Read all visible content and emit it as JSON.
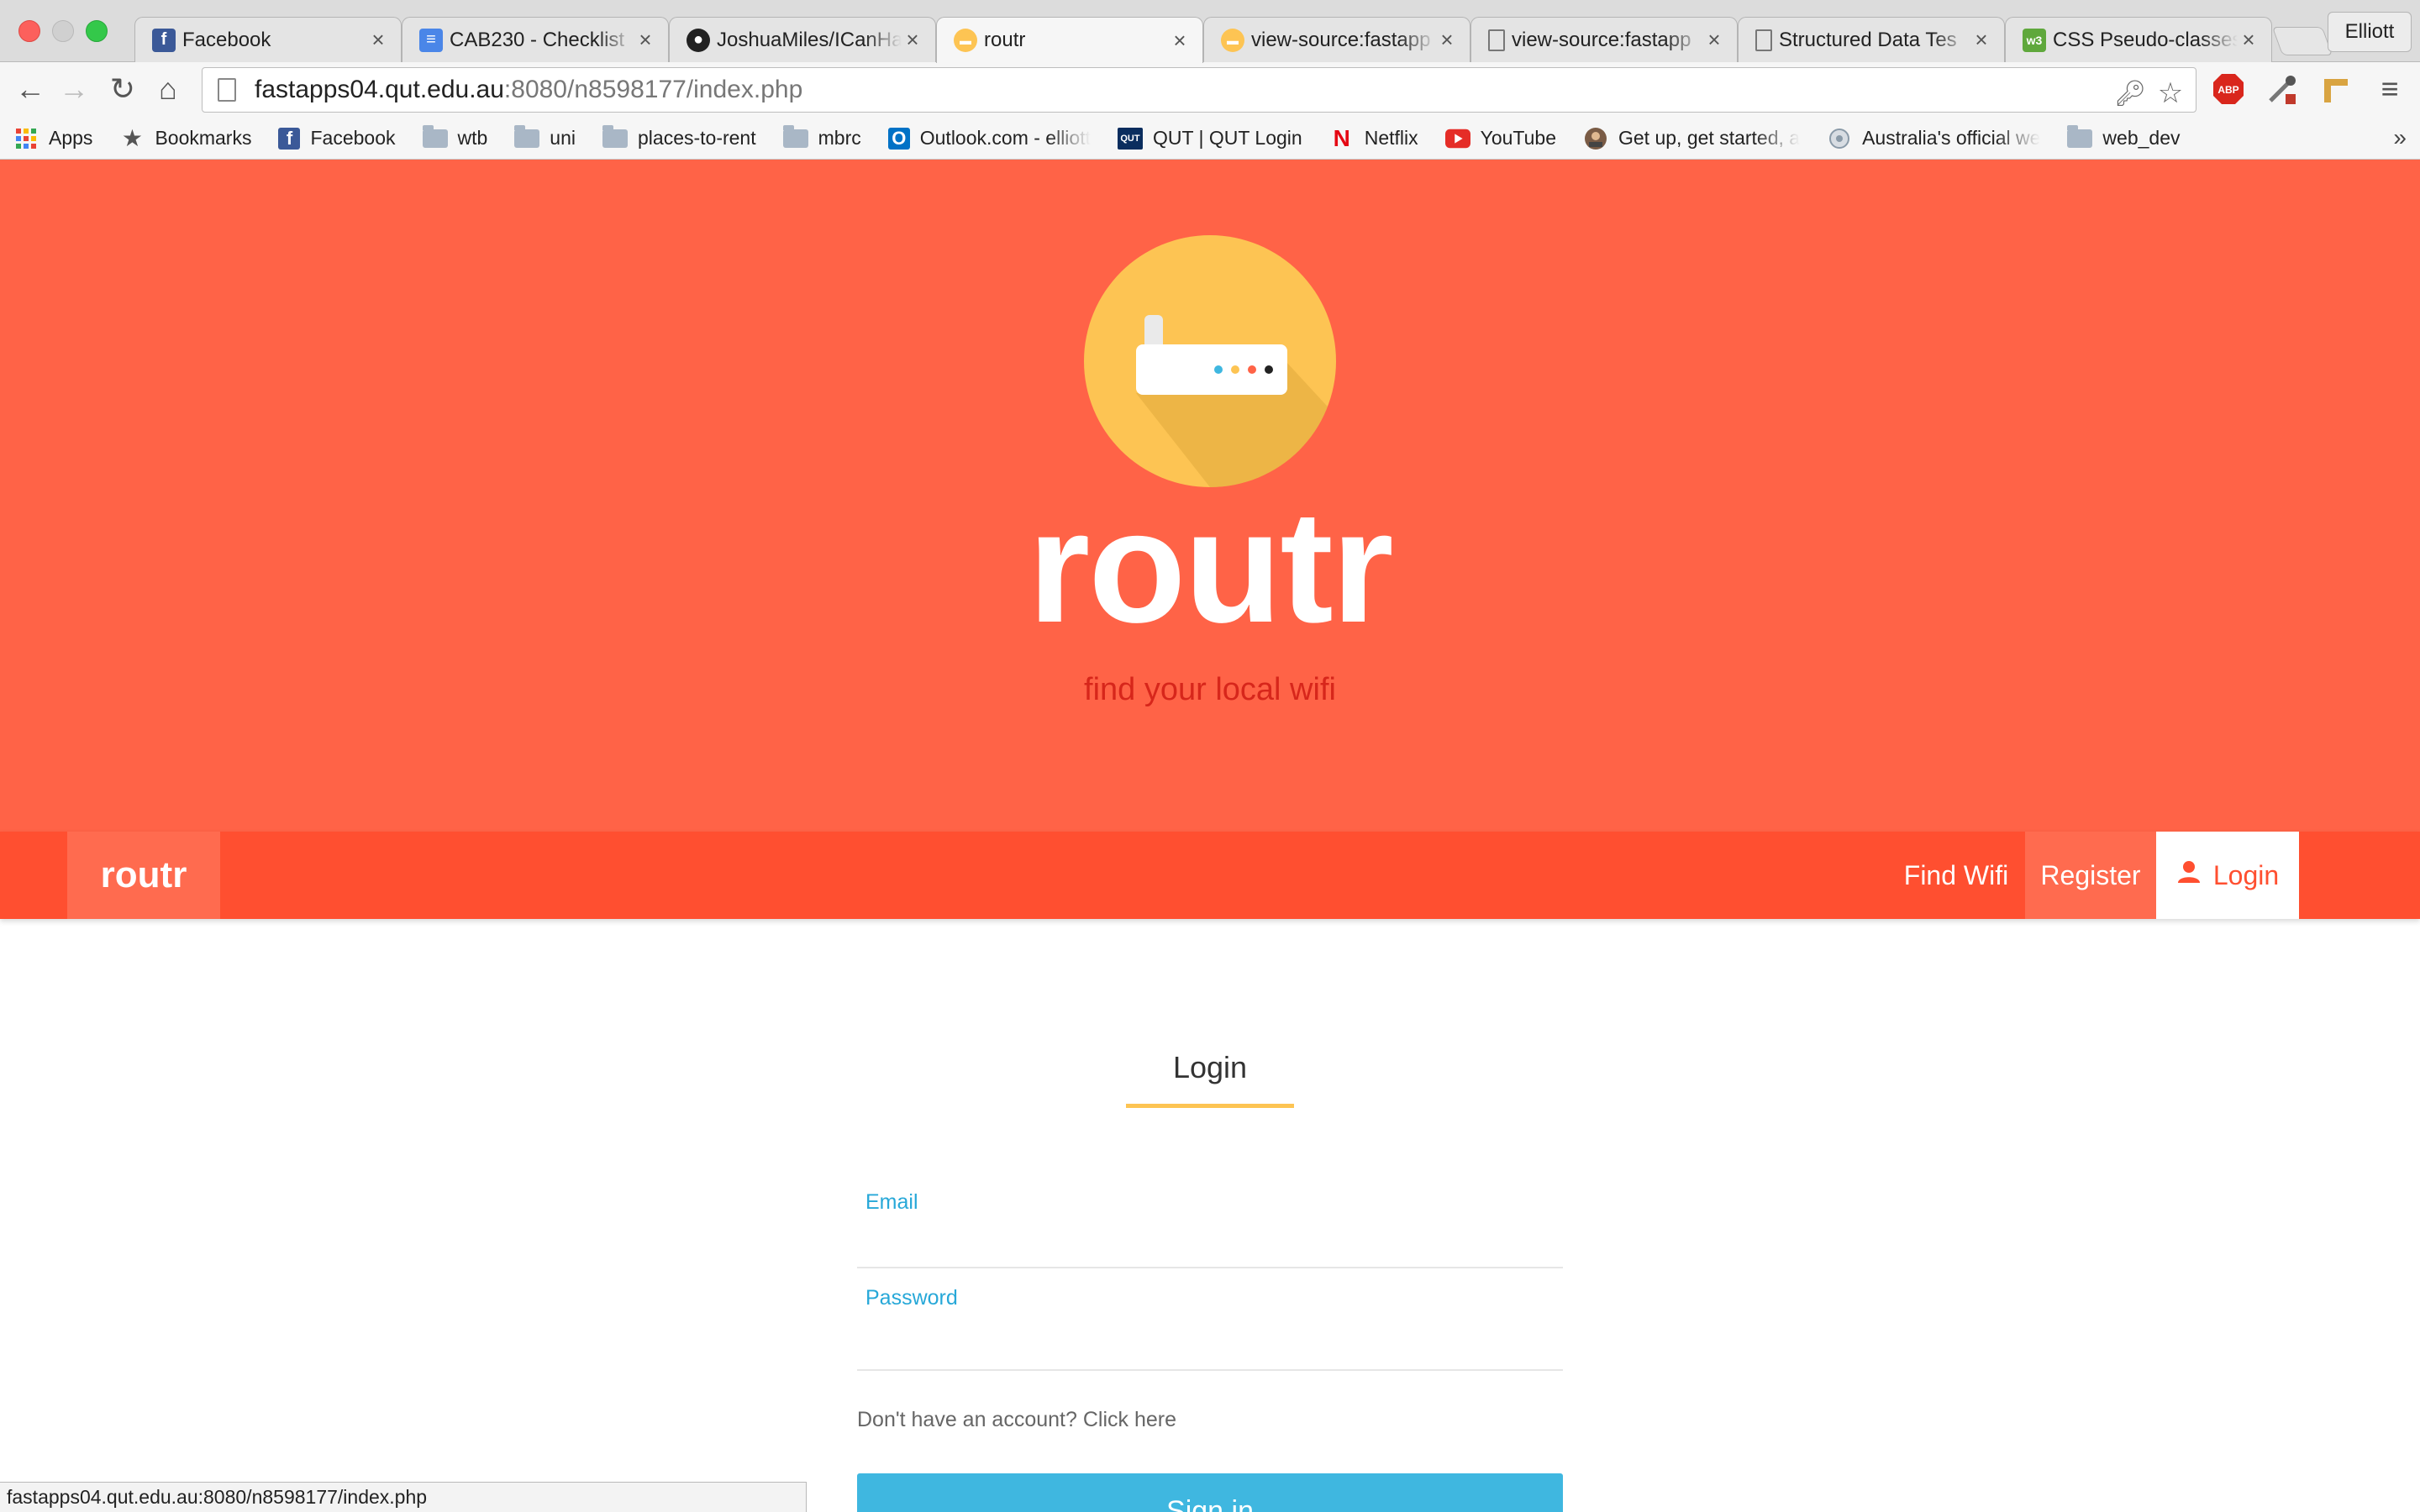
{
  "browser": {
    "tabs": [
      {
        "title": "Facebook",
        "icon": "facebook-icon",
        "active": false
      },
      {
        "title": "CAB230 - Checklist",
        "icon": "google-docs-icon",
        "active": false
      },
      {
        "title": "JoshuaMiles/ICanHa",
        "icon": "github-icon",
        "active": false
      },
      {
        "title": "routr",
        "icon": "routr-icon",
        "active": true
      },
      {
        "title": "view-source:fastapp",
        "icon": "routr-icon",
        "active": false
      },
      {
        "title": "view-source:fastapp",
        "icon": "page-icon",
        "active": false
      },
      {
        "title": "Structured Data Tes",
        "icon": "page-icon",
        "active": false
      },
      {
        "title": "CSS Pseudo-classes",
        "icon": "w3-icon",
        "active": false
      }
    ],
    "profile_name": "Elliott",
    "url_host": "fastapps04.qut.edu.au",
    "url_rest": ":8080/n8598177/index.php",
    "bookmarks": [
      {
        "label": "Apps",
        "icon": "apps-grid-icon"
      },
      {
        "label": "Bookmarks",
        "icon": "star-icon"
      },
      {
        "label": "Facebook",
        "icon": "facebook-icon"
      },
      {
        "label": "wtb",
        "icon": "folder-icon"
      },
      {
        "label": "uni",
        "icon": "folder-icon"
      },
      {
        "label": "places-to-rent",
        "icon": "folder-icon"
      },
      {
        "label": "mbrc",
        "icon": "folder-icon"
      },
      {
        "label": "Outlook.com - elliott",
        "icon": "outlook-icon"
      },
      {
        "label": "QUT | QUT Login",
        "icon": "qut-icon"
      },
      {
        "label": "Netflix",
        "icon": "netflix-icon"
      },
      {
        "label": "YouTube",
        "icon": "youtube-icon"
      },
      {
        "label": "Get up, get started, a",
        "icon": "avatar-icon"
      },
      {
        "label": "Australia's official we",
        "icon": "globe-icon"
      },
      {
        "label": "web_dev",
        "icon": "folder-icon"
      }
    ],
    "extensions": {
      "adblock": "ABP"
    },
    "status_url": "fastapps04.qut.edu.au:8080/n8598177/index.php"
  },
  "hero": {
    "title": "routr",
    "tagline": "find your local wifi",
    "logo_icon": "router-icon"
  },
  "nav": {
    "brand": "routr",
    "links": {
      "find_wifi": "Find Wifi",
      "register": "Register",
      "login": "Login"
    }
  },
  "login_form": {
    "heading": "Login",
    "email_label": "Email",
    "email_value": "",
    "password_label": "Password",
    "password_value": "",
    "register_hint": "Don't have an account? Click here",
    "submit_label": "Sign in"
  },
  "colors": {
    "hero_bg": "#ff6347",
    "navbar_bg": "#ff4f30",
    "accent_yellow": "#fdc453",
    "accent_blue": "#3fb7e0",
    "tagline": "#d7261b"
  }
}
